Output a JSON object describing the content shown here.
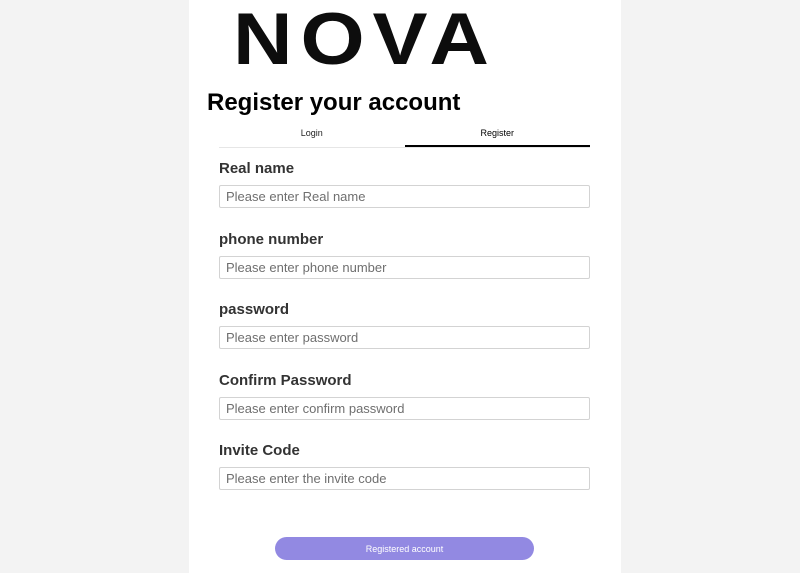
{
  "brand": {
    "logo_text": "NOVA"
  },
  "page_title": "Register your account",
  "tabs": [
    {
      "label": "Login",
      "active": false
    },
    {
      "label": "Register",
      "active": true
    }
  ],
  "form": {
    "fields": [
      {
        "label": "Real name",
        "placeholder": "Please enter Real name",
        "value": ""
      },
      {
        "label": "phone number",
        "placeholder": "Please enter phone number",
        "value": ""
      },
      {
        "label": "password",
        "placeholder": "Please enter password",
        "value": ""
      },
      {
        "label": "Confirm Password",
        "placeholder": "Please enter confirm password",
        "value": ""
      },
      {
        "label": "Invite Code",
        "placeholder": "Please enter the invite code",
        "value": ""
      }
    ],
    "submit_label": "Registered account"
  },
  "colors": {
    "background": "#f3f3f3",
    "card": "#ffffff",
    "accent_button": "#9289e2",
    "active_tab_underline": "#000000"
  }
}
